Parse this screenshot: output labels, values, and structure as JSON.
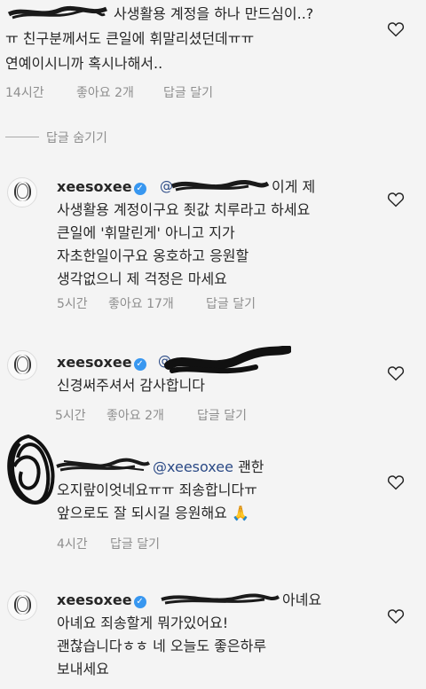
{
  "comments": [
    {
      "lines": [
        "사생활용 계정을 하나 만드심이..?",
        "ㅠ 친구분께서도 큰일에 휘말리셨던데ㅠㅠ",
        "연예이시니까 혹시나해서.."
      ],
      "time": "14시간",
      "likes": "좋아요 2개",
      "reply": "답글 달기"
    },
    {
      "hide_replies": "답글 숨기기"
    },
    {
      "username": "xeesoxee",
      "first_line_rest": "이게 제",
      "lines": [
        "사생활용 계정이구요 죗값 치루라고 하세요",
        "큰일에 '휘말린게' 아니고 지가",
        "자초한일이구요 옹호하고 응원할",
        "생각없으니 제 걱정은 마세요"
      ],
      "time": "5시간",
      "likes": "좋아요 17개",
      "reply": "답글 달기"
    },
    {
      "username": "xeesoxee",
      "lines": [
        "신경써주셔서 감사합니다"
      ],
      "time": "5시간",
      "likes": "좋아요 2개",
      "reply": "답글 달기"
    },
    {
      "mention": "@xeesoxee",
      "first_line_rest": "괜한",
      "lines": [
        "오지랖이엇네요ㅠㅠ 죄송합니다ㅠ",
        "앞으로도 잘 되시길 응원해요"
      ],
      "emoji": "🙏",
      "time": "4시간",
      "reply": "답글 달기"
    },
    {
      "username": "xeesoxee",
      "first_line_rest": "아녜요",
      "lines": [
        "아녜요 죄송할게 뭐가있어요!",
        "괜찮습니다ㅎㅎ 네 오늘도 좋은하루",
        "보내세요"
      ]
    }
  ],
  "icons": {
    "heart": "heart-outline-icon",
    "verified": "verified-badge-icon",
    "avatar": "profile-avatar"
  },
  "colors": {
    "mention": "#2b4a86",
    "meta": "#8e8e8e",
    "verified": "#3897f0"
  }
}
